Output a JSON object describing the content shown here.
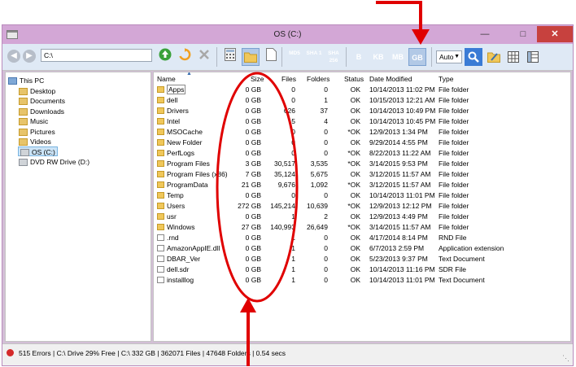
{
  "window": {
    "title": "OS (C:)"
  },
  "toolbar": {
    "path": "C:\\",
    "hash_buttons": [
      {
        "label": "MD5"
      },
      {
        "label": "SHA 1"
      },
      {
        "label": "SHA 256"
      }
    ],
    "unit_buttons": [
      {
        "label": "B"
      },
      {
        "label": "KB"
      },
      {
        "label": "MB"
      },
      {
        "label": "GB",
        "active": true
      }
    ],
    "unit_mode": "Auto"
  },
  "tree": [
    {
      "label": "This PC",
      "icon": "computer-icon"
    },
    {
      "label": "Desktop",
      "icon": "folder-icon"
    },
    {
      "label": "Documents",
      "icon": "folder-icon"
    },
    {
      "label": "Downloads",
      "icon": "folder-icon"
    },
    {
      "label": "Music",
      "icon": "folder-icon"
    },
    {
      "label": "Pictures",
      "icon": "folder-icon"
    },
    {
      "label": "Videos",
      "icon": "folder-icon"
    },
    {
      "label": "OS (C:)",
      "icon": "drive-icon",
      "selected": true
    },
    {
      "label": "DVD RW Drive (D:)",
      "icon": "dvd-drive-icon"
    }
  ],
  "columns": [
    "Name",
    "Size",
    "Files",
    "Folders",
    "Status",
    "Date Modified",
    "Type"
  ],
  "rows": [
    {
      "name": "Apps",
      "kind": "folder",
      "size": "0 GB",
      "files": "0",
      "folders": "0",
      "status": "OK",
      "modified": "10/14/2013 11:02 PM",
      "type": "File folder"
    },
    {
      "name": "dell",
      "kind": "folder",
      "size": "0 GB",
      "files": "0",
      "folders": "1",
      "status": "OK",
      "modified": "10/15/2013 12:21 AM",
      "type": "File folder"
    },
    {
      "name": "Drivers",
      "kind": "folder",
      "size": "0 GB",
      "files": "626",
      "folders": "37",
      "status": "OK",
      "modified": "10/14/2013 10:49 PM",
      "type": "File folder"
    },
    {
      "name": "Intel",
      "kind": "folder",
      "size": "0 GB",
      "files": "5",
      "folders": "4",
      "status": "OK",
      "modified": "10/14/2013 10:45 PM",
      "type": "File folder"
    },
    {
      "name": "MSOCache",
      "kind": "folder",
      "size": "0 GB",
      "files": "0",
      "folders": "0",
      "status": "*OK",
      "modified": "12/9/2013 1:34 PM",
      "type": "File folder"
    },
    {
      "name": "New Folder",
      "kind": "folder",
      "size": "0 GB",
      "files": "0",
      "folders": "0",
      "status": "OK",
      "modified": "9/29/2014 4:55 PM",
      "type": "File folder"
    },
    {
      "name": "PerfLogs",
      "kind": "folder",
      "size": "0 GB",
      "files": "0",
      "folders": "0",
      "status": "*OK",
      "modified": "8/22/2013 11:22 AM",
      "type": "File folder"
    },
    {
      "name": "Program Files",
      "kind": "folder",
      "size": "3 GB",
      "files": "30,517",
      "folders": "3,535",
      "status": "*OK",
      "modified": "3/14/2015 9:53 PM",
      "type": "File folder"
    },
    {
      "name": "Program Files (x86)",
      "kind": "folder",
      "size": "7 GB",
      "files": "35,124",
      "folders": "5,675",
      "status": "OK",
      "modified": "3/12/2015 11:57 AM",
      "type": "File folder"
    },
    {
      "name": "ProgramData",
      "kind": "folder",
      "size": "21 GB",
      "files": "9,676",
      "folders": "1,092",
      "status": "*OK",
      "modified": "3/12/2015 11:57 AM",
      "type": "File folder"
    },
    {
      "name": "Temp",
      "kind": "folder",
      "size": "0 GB",
      "files": "0",
      "folders": "0",
      "status": "OK",
      "modified": "10/14/2013 11:01 PM",
      "type": "File folder"
    },
    {
      "name": "Users",
      "kind": "folder",
      "size": "272 GB",
      "files": "145,214",
      "folders": "10,639",
      "status": "*OK",
      "modified": "12/9/2013 12:12 PM",
      "type": "File folder"
    },
    {
      "name": "usr",
      "kind": "folder",
      "size": "0 GB",
      "files": "1",
      "folders": "2",
      "status": "OK",
      "modified": "12/9/2013 4:49 PM",
      "type": "File folder"
    },
    {
      "name": "Windows",
      "kind": "folder",
      "size": "27 GB",
      "files": "140,993",
      "folders": "26,649",
      "status": "*OK",
      "modified": "3/14/2015 11:57 AM",
      "type": "File folder"
    },
    {
      "name": ".rnd",
      "kind": "file",
      "size": "0 GB",
      "files": "1",
      "folders": "0",
      "status": "OK",
      "modified": "4/17/2014 8:14 PM",
      "type": "RND File"
    },
    {
      "name": "AmazonAppIE.dll",
      "kind": "file",
      "size": "0 GB",
      "files": "1",
      "folders": "0",
      "status": "OK",
      "modified": "6/7/2013 2:59 PM",
      "type": "Application extension"
    },
    {
      "name": "DBAR_Ver",
      "kind": "file",
      "size": "0 GB",
      "files": "1",
      "folders": "0",
      "status": "OK",
      "modified": "5/23/2013 9:37 PM",
      "type": "Text Document"
    },
    {
      "name": "dell.sdr",
      "kind": "file",
      "size": "0 GB",
      "files": "1",
      "folders": "0",
      "status": "OK",
      "modified": "10/14/2013 11:16 PM",
      "type": "SDR File"
    },
    {
      "name": "installlog",
      "kind": "file",
      "size": "0 GB",
      "files": "1",
      "folders": "0",
      "status": "OK",
      "modified": "10/14/2013 11:01 PM",
      "type": "Text Document"
    }
  ],
  "status": {
    "text": "515 Errors  |  C:\\ Drive 29% Free  |  C:\\ 332  GB  |  362071 Files  |  47648 Folders  |  0.54 secs"
  },
  "colors": {
    "title_bar": "#d3a7d6",
    "close_button": "#c7413e",
    "toolbar": "#dfe9f5",
    "annotation": "#e00000"
  }
}
